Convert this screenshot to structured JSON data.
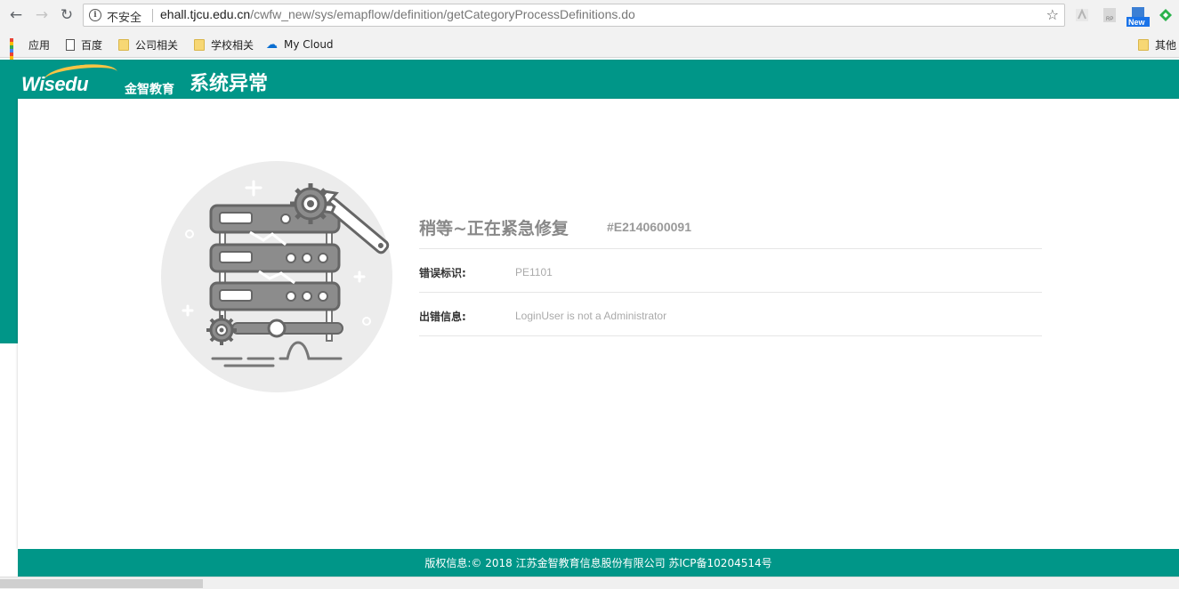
{
  "browser": {
    "back_icon": "arrow-left-icon",
    "forward_icon": "arrow-right-icon",
    "reload_icon": "reload-icon",
    "security_label": "不安全",
    "url_host": "ehall.tjcu.edu.cn",
    "url_path": "/cwfw_new/sys/emapflow/definition/getCategoryProcessDefinitions.do",
    "extensions": [
      "pdf-icon",
      "rp-icon",
      "new-badge-icon",
      "feedly-icon"
    ],
    "new_badge": "New",
    "rp_label": "RP"
  },
  "bookmarks": {
    "apps": "应用",
    "items": [
      {
        "label": "百度",
        "icon": "page-icon"
      },
      {
        "label": "公司相关",
        "icon": "folder-icon"
      },
      {
        "label": "学校相关",
        "icon": "folder-icon"
      },
      {
        "label": "My Cloud",
        "icon": "cloud-icon"
      }
    ],
    "other": "其他"
  },
  "header": {
    "logo_text": "Wisedu",
    "logo_cn": "金智教育",
    "title": "系统异常"
  },
  "error": {
    "heading": "稍等~正在紧急修复",
    "code": "#E2140600091",
    "rows": [
      {
        "label": "错误标识:",
        "value": "PE1101"
      },
      {
        "label": "出错信息:",
        "value": "LoginUser is not a Administrator"
      }
    ]
  },
  "footer": {
    "copyright": "版权信息:© 2018 江苏金智教育信息股份有限公司 苏ICP备10204514号"
  },
  "colors": {
    "brand": "#009688",
    "logo_accent": "#f6c445"
  }
}
